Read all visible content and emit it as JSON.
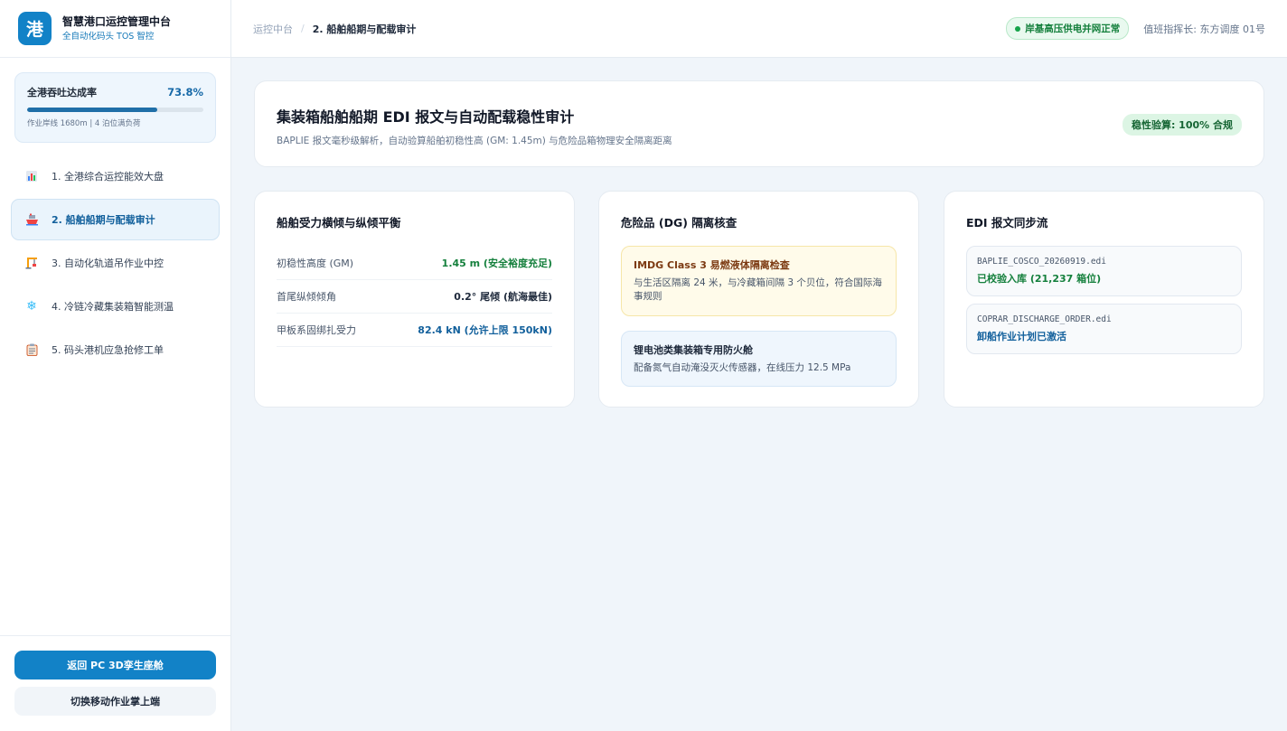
{
  "brand": {
    "logo_char": "港",
    "title": "智慧港口运控管理中台",
    "subtitle": "全自动化码头 TOS 智控"
  },
  "kpi": {
    "label": "全港吞吐达成率",
    "value": "73.8%",
    "progress_percent": 73.8,
    "note": "作业岸线 1680m | 4 泊位满负荷"
  },
  "nav": {
    "items": [
      {
        "label": "1. 全港综合运控能效大盘",
        "icon": "bar-chart-icon"
      },
      {
        "label": "2. 船舶船期与配载审计",
        "icon": "ship-icon",
        "active": true
      },
      {
        "label": "3. 自动化轨道吊作业中控",
        "icon": "crane-icon"
      },
      {
        "label": "4. 冷链冷藏集装箱智能测温",
        "icon": "snowflake-icon"
      },
      {
        "label": "5. 码头港机应急抢修工单",
        "icon": "clipboard-icon"
      }
    ]
  },
  "footer": {
    "primary_button": "返回 PC 3D孪生座舱",
    "secondary_button": "切换移动作业掌上端"
  },
  "header": {
    "breadcrumb_root": "运控中台",
    "breadcrumb_sep": "/",
    "breadcrumb_current": "2. 船舶船期与配载审计",
    "power_status": "岸基高压供电并网正常",
    "duty_officer": "值班指挥长: 东方调度 01号"
  },
  "hero": {
    "title": "集装箱船舶船期 EDI 报文与自动配载稳性审计",
    "subtitle": "BAPLIE 报文毫秒级解析，自动验算船舶初稳性高 (GM: 1.45m) 与危险品箱物理安全隔离距离",
    "badge": "稳性验算: 100% 合规"
  },
  "stability": {
    "title": "船舶受力横倾与纵倾平衡",
    "rows": [
      {
        "label": "初稳性高度 (GM)",
        "value": "1.45 m (安全裕度充足)"
      },
      {
        "label": "首尾纵倾倾角",
        "value": "0.2° 尾倾 (航海最佳)"
      },
      {
        "label": "甲板系固绑扎受力",
        "value": "82.4 kN (允许上限 150kN)"
      }
    ]
  },
  "dg": {
    "title": "危险品 (DG) 隔离核查",
    "warn": {
      "title": "IMDG Class 3 易燃液体隔离检查",
      "desc": "与生活区隔离 24 米，与冷藏箱间隔 3 个贝位，符合国际海事规则"
    },
    "info": {
      "title": "锂电池类集装箱专用防火舱",
      "desc": "配备氮气自动淹没灭火传感器，在线压力 12.5 MPa"
    }
  },
  "edi": {
    "title": "EDI 报文同步流",
    "items": [
      {
        "file": "BAPLIE_COSCO_20260919.edi",
        "status": "已校验入库 (21,237 箱位)"
      },
      {
        "file": "COPRAR_DISCHARGE_ORDER.edi",
        "status": "卸船作业计划已激活"
      }
    ]
  },
  "colors": {
    "brand": "#1282c7",
    "success": "#15803d",
    "value_blue": "#12609c"
  }
}
